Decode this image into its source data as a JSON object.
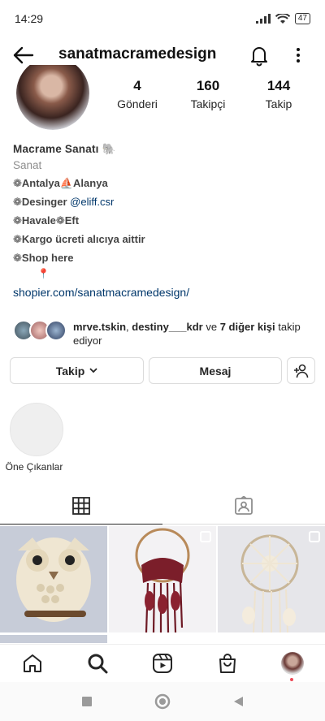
{
  "status_bar": {
    "time": "14:29",
    "battery": "47"
  },
  "header": {
    "username": "sanatmacramedesign"
  },
  "stats": [
    {
      "value": "4",
      "label": "Gönderi"
    },
    {
      "value": "160",
      "label": "Takipçi"
    },
    {
      "value": "144",
      "label": "Takip"
    }
  ],
  "bio": {
    "name": "Macrame Sanatı 🐘",
    "category": "Sanat",
    "location": "❁Antalya⛵Alanya",
    "designer_prefix": "❁Desinger ",
    "designer_mention": "@eliff.csr",
    "payment": "❁Havale❁Eft",
    "shipping": "❁Kargo ücreti alıcıya aittir",
    "shop": "❁Shop here",
    "pin": "📍",
    "link": "shopier.com/sanatmacramedesign/"
  },
  "followed_by": {
    "user1": "mrve.tskin",
    "separator": ", ",
    "user2": "destiny___kdr",
    "and": " ve ",
    "others": "7 diğer kişi",
    "suffix": " takip ediyor"
  },
  "buttons": {
    "follow": "Takip",
    "message": "Mesaj"
  },
  "highlight": {
    "label": "Öne Çıkanlar"
  },
  "colors": {
    "link": "#00376b",
    "muted": "#8e8e8e",
    "border": "#dbdbdb",
    "notification_dot": "#ed4956"
  },
  "icons": {
    "back": "arrow-left-icon",
    "bell": "bell-icon",
    "more": "more-vertical-icon",
    "grid": "grid-icon",
    "tagged": "tagged-person-icon",
    "home": "home-icon",
    "search": "search-icon",
    "reels": "reels-icon",
    "shop": "shopping-bag-icon"
  }
}
